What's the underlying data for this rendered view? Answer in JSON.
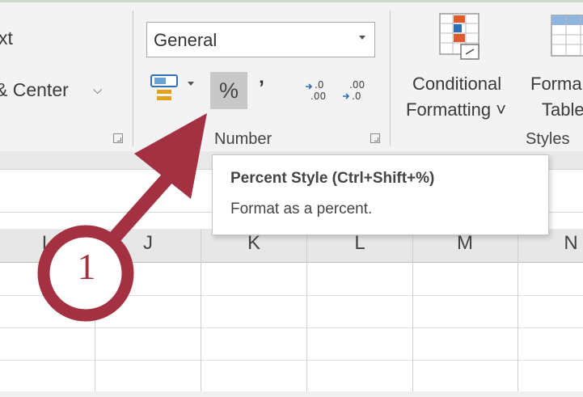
{
  "ribbon": {
    "alignment": {
      "wrap_text_partial": "xt",
      "merge_center_partial": "& Center"
    },
    "number": {
      "format_value": "General",
      "percent_glyph": "%",
      "comma_glyph": "’",
      "increase_decimal": ".0\n.00",
      "decrease_decimal": ".00\n→.0",
      "label": "Number"
    },
    "styles": {
      "conditional_line1": "Conditional",
      "conditional_line2": "Formatting ˅",
      "format_table_line1": "Forma",
      "format_table_line2": "Table",
      "label": "Styles"
    }
  },
  "tooltip": {
    "title": "Percent Style (Ctrl+Shift+%)",
    "description": "Format as a percent."
  },
  "columns": [
    "I",
    "J",
    "K",
    "L",
    "M",
    "N"
  ],
  "callout": {
    "number": "1",
    "color": "#a33142"
  },
  "colors": {
    "ribbon_bg": "#f3f3f3",
    "selected_button": "#c8c8c8",
    "header_bg": "#e7e7e7",
    "callout_red": "#a33142"
  }
}
